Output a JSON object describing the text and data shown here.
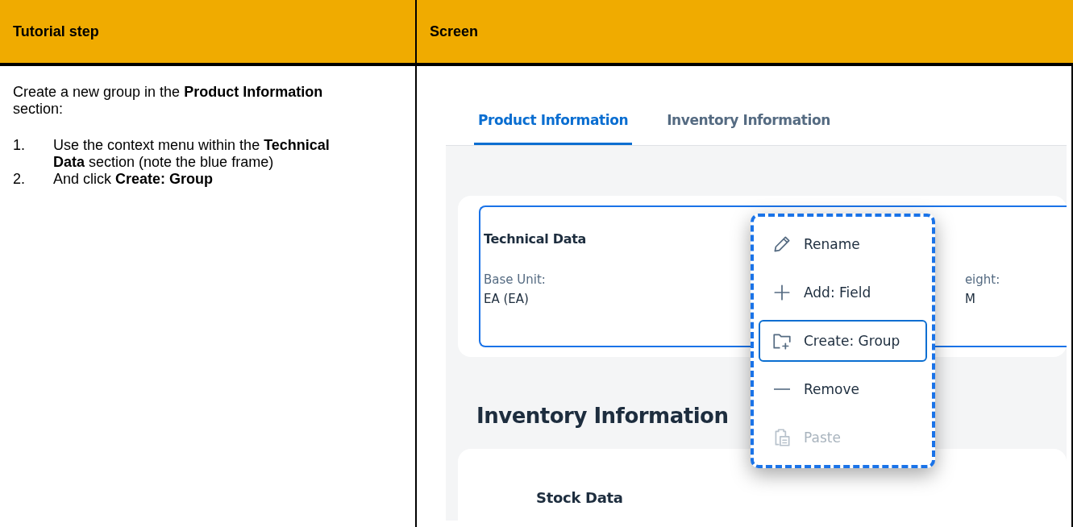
{
  "table": {
    "columns": [
      "Tutorial step",
      "Screen"
    ]
  },
  "step": {
    "intro": "Create a new group in the **Product Information** section:",
    "items": [
      {
        "number": "1.",
        "text": "Use the context menu within the **Technical Data** section (note the blue frame)"
      },
      {
        "number": "2.",
        "text": "And click **Create: Group**"
      }
    ]
  },
  "screen": {
    "tabs": [
      {
        "label": "Product Information",
        "selected": true
      },
      {
        "label": "Inventory Information",
        "selected": false
      }
    ],
    "section": {
      "title": "Technical Data",
      "fields": [
        {
          "label": "Base Unit:",
          "value": "EA (EA)"
        },
        {
          "label": "eight:",
          "value": "M"
        }
      ]
    },
    "context_menu": {
      "items": [
        {
          "label": "Rename",
          "selected": false,
          "disabled": false
        },
        {
          "label": "Add: Field",
          "selected": false,
          "disabled": false
        },
        {
          "label": "Create: Group",
          "selected": true,
          "disabled": false
        },
        {
          "label": "Remove",
          "selected": false,
          "disabled": false
        },
        {
          "label": "Paste",
          "selected": false,
          "disabled": true
        }
      ]
    },
    "heading": "Inventory Information",
    "subsection": "Stock Data"
  }
}
